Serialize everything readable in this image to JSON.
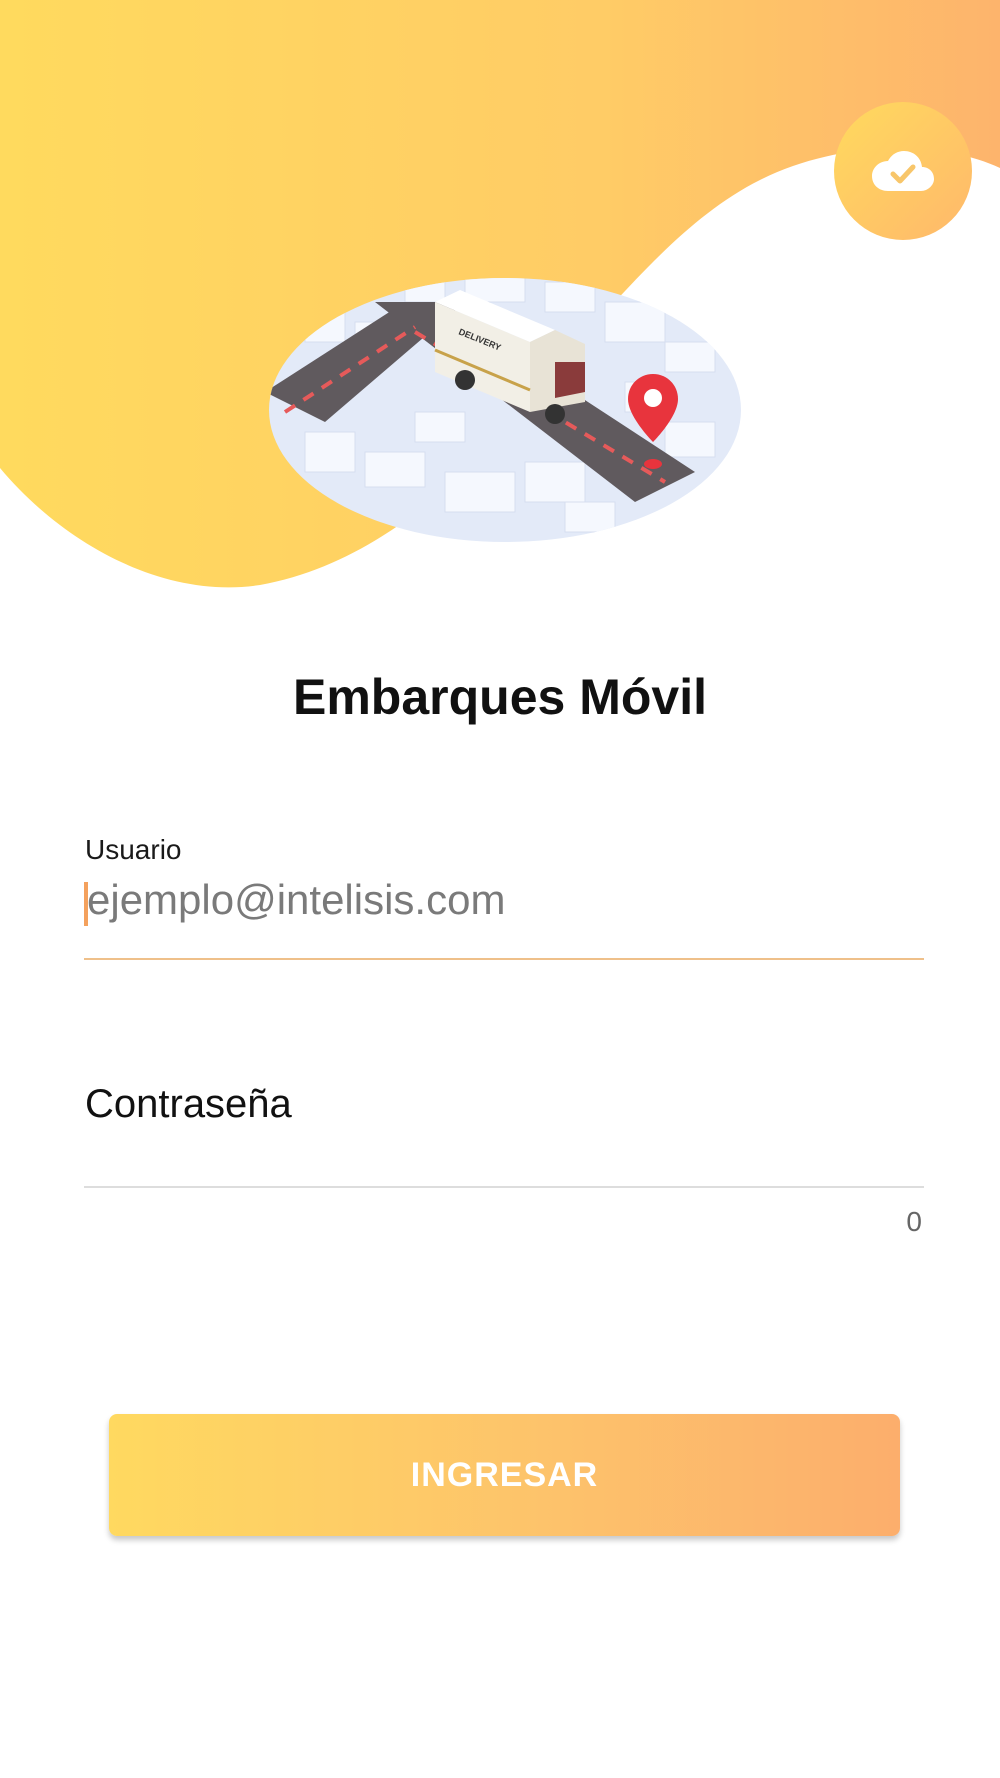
{
  "app": {
    "title": "Embarques Móvil"
  },
  "header": {
    "sync_icon": "cloud-check-icon",
    "illustration": "delivery-truck-city-map",
    "illustration_truck_text": "DELIVERY"
  },
  "form": {
    "user_label": "Usuario",
    "user_value": "ejemplo@intelisis.com",
    "password_label": "Contraseña",
    "password_counter": "0"
  },
  "actions": {
    "login_label": "INGRESAR"
  },
  "colors": {
    "gradient_start": "#FFDA5E",
    "gradient_end": "#FCAE6C",
    "focus_underline": "#EFC08A"
  }
}
